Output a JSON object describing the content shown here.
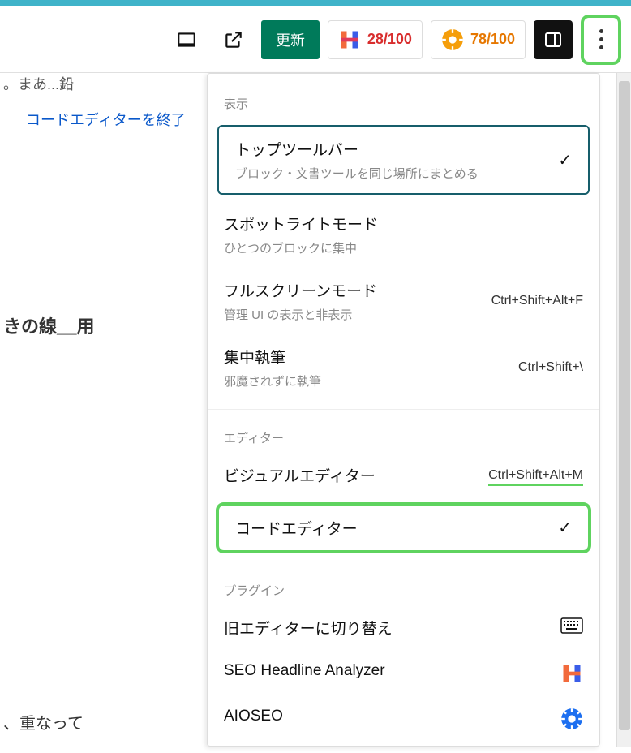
{
  "toolbar": {
    "update_label": "更新",
    "score1": "28/100",
    "score2": "78/100"
  },
  "editor": {
    "snippet1": "。まあ...鉛",
    "exit_link": "コードエディターを終了",
    "snippet2": "きの線__用",
    "snippet3": "、重なって"
  },
  "menu": {
    "sections": {
      "display": "表示",
      "editor": "エディター",
      "plugins": "プラグイン"
    },
    "items": {
      "top_toolbar": {
        "label": "トップツールバー",
        "desc": "ブロック・文書ツールを同じ場所にまとめる"
      },
      "spotlight": {
        "label": "スポットライトモード",
        "desc": "ひとつのブロックに集中"
      },
      "fullscreen": {
        "label": "フルスクリーンモード",
        "desc": "管理 UI の表示と非表示",
        "shortcut": "Ctrl+Shift+Alt+F"
      },
      "focus": {
        "label": "集中執筆",
        "desc": "邪魔されずに執筆",
        "shortcut": "Ctrl+Shift+\\"
      },
      "visual": {
        "label": "ビジュアルエディター",
        "shortcut": "Ctrl+Shift+Alt+M"
      },
      "code": {
        "label": "コードエディター"
      },
      "old_editor": {
        "label": "旧エディターに切り替え"
      },
      "seo_headline": {
        "label": "SEO Headline Analyzer"
      },
      "aioseo": {
        "label": "AIOSEO"
      }
    }
  }
}
